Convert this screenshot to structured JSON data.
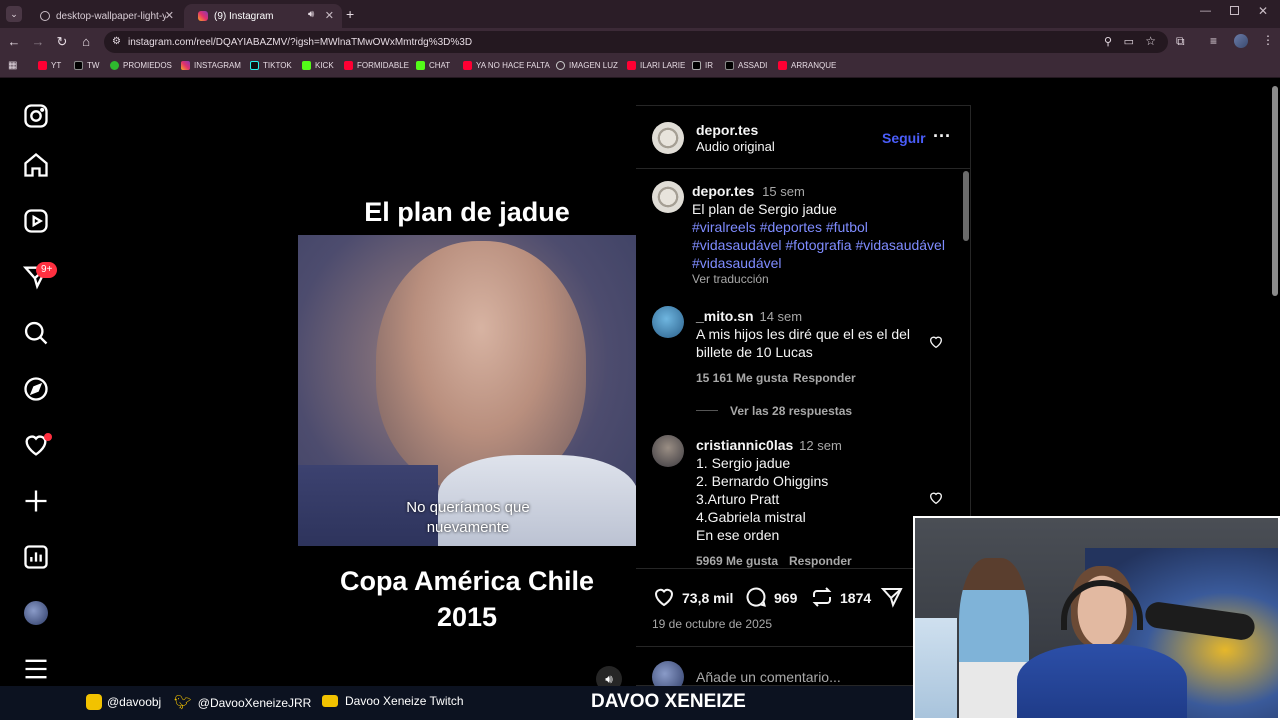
{
  "browser": {
    "tabs": [
      {
        "title": "desktop-wallpaper-light-yellow",
        "active": false
      },
      {
        "title": "(9) Instagram",
        "active": true
      }
    ],
    "url": "instagram.com/reel/DQAYIABAZMV/?igsh=MWlnaTMwOWxMmtrdg%3D%3D",
    "bookmarks": [
      "YT",
      "TW",
      "PROMIEDOS",
      "INSTAGRAM",
      "TIKTOK",
      "KICK",
      "FORMIDABLE",
      "CHAT",
      "YA NO HACE FALTA",
      "IMAGEN LUZ",
      "ILARI LARIE",
      "IR",
      "ASSADI",
      "ARRANQUE"
    ]
  },
  "sidebar": {
    "notification_badge": "9+"
  },
  "reel": {
    "title": "El plan de jadue",
    "subtitle_line1": "No queríamos que",
    "subtitle_line2": "nuevamente",
    "caption_line1": "Copa América Chile",
    "caption_line2": "2015"
  },
  "post": {
    "author": "depor.tes",
    "audio": "Audio original",
    "follow_label": "Seguir",
    "caption": {
      "author": "depor.tes",
      "time": "15 sem",
      "text": "El plan de Sergio jadue",
      "hashtags_line1": "#viralreels #deportes #futbol",
      "hashtags_line2": "#vidasaudável #fotografia #vidasaudável",
      "hashtags_line3": "#vidasaudável",
      "translate": "Ver traducción"
    },
    "comments": [
      {
        "user": "_mito.sn",
        "time": "14 sem",
        "lines": [
          "A mis hijos les diré que el es el del",
          "billete de 10 Lucas"
        ],
        "likes": "15 161 Me gusta",
        "reply": "Responder",
        "view_replies": "Ver las 28 respuestas"
      },
      {
        "user": "cristiannic0las",
        "time": "12 sem",
        "lines": [
          "1. Sergio jadue",
          "2. Bernardo Ohiggins",
          "3.Arturo Pratt",
          "4.Gabriela mistral",
          "En ese orden"
        ],
        "likes": "5969 Me gusta",
        "reply": "Responder"
      }
    ],
    "stats": {
      "likes": "73,8 mil",
      "comments": "969",
      "reposts": "1874"
    },
    "date": "19 de octubre de 2025",
    "comment_placeholder": "Añade un comentario..."
  },
  "overlay": {
    "instagram": "@davoobj",
    "twitter": "@DavooXeneizeJRR",
    "twitch": "Davoo Xeneize Twitch",
    "name": "DAVOO XENEIZE"
  },
  "colors": {
    "follow": "#4a5df9",
    "hashtag": "#7f8cff",
    "badge": "#ff3040",
    "browser_bg": "#3c2a37"
  }
}
